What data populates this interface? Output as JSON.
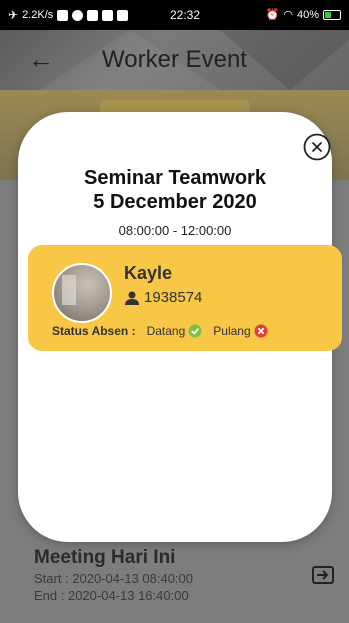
{
  "statusbar": {
    "speed": "2.2K/s",
    "time": "22:32",
    "battery": "40%"
  },
  "appbar": {
    "back_icon": "arrow-left-icon",
    "title": "Worker Event"
  },
  "modal": {
    "close_icon": "close-circle-icon",
    "event_title_line1": "Seminar Teamwork",
    "event_title_line2": "5 December 2020",
    "event_time": "08:00:00 - 12:00:00",
    "card": {
      "color": "#f8c745",
      "name": "Kayle",
      "user_id": "1938574",
      "status_label": "Status Absen :",
      "status_in_label": "Datang",
      "status_in_state": "ok",
      "status_out_label": "Pulang",
      "status_out_state": "missing"
    }
  },
  "meeting": {
    "title": "Meeting Hari Ini",
    "start": "Start :  2020-04-13 08:40:00",
    "end": "End : 2020-04-13 16:40:00"
  }
}
